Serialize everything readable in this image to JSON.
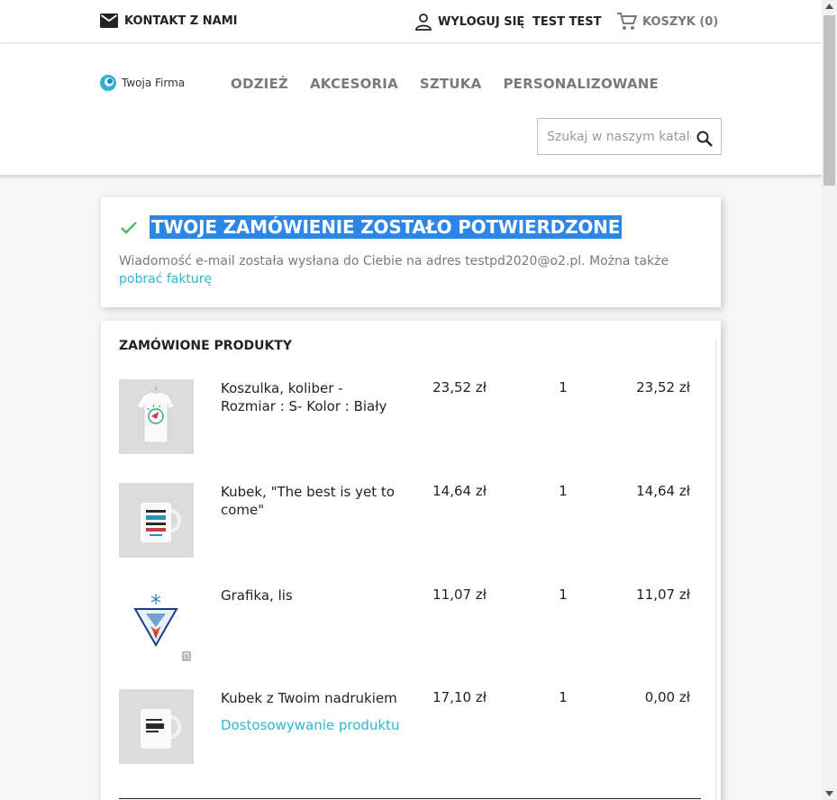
{
  "topbar": {
    "contact_label": "KONTAKT Z NAMI",
    "logout_label": "WYLOGUJ SIĘ",
    "username": "TEST TEST",
    "cart_label": "KOSZYK (0)"
  },
  "header": {
    "logo_text": "Twoja Firma",
    "nav": [
      "ODZIEŻ",
      "AKCESORIA",
      "SZTUKA",
      "PERSONALIZOWANE"
    ],
    "search_placeholder": "Szukaj w naszym katalogu"
  },
  "confirmation": {
    "title": "TWOJE ZAMÓWIENIE ZOSTAŁO POTWIERDZONE",
    "message": "Wiadomość e-mail została wysłana do Ciebie na adres testpd2020@o2.pl. Można także ",
    "invoice_link": "pobrać fakturę"
  },
  "order": {
    "title": "ZAMÓWIONE PRODUKTY",
    "items": [
      {
        "name": "Koszulka, koliber - Rozmiar : S- Kolor : Biały",
        "price": "23,52 zł",
        "qty": "1",
        "total": "23,52 zł",
        "image": "tshirt-hummingbird-icon"
      },
      {
        "name": "Kubek, \"The best is yet to come\"",
        "price": "14,64 zł",
        "qty": "1",
        "total": "14,64 zł",
        "image": "mug-best-icon"
      },
      {
        "name": "Grafika, lis",
        "price": "11,07 zł",
        "qty": "1",
        "total": "11,07 zł",
        "image": "fox-graphic-icon"
      },
      {
        "name": "Kubek z Twoim nadrukiem",
        "customization": "Dostosowywanie produktu",
        "price": "17,10 zł",
        "qty": "1",
        "total": "0,00 zł",
        "image": "mug-custom-icon"
      }
    ]
  },
  "colors": {
    "accent": "#2fb5d2",
    "selection": "#2b86e6",
    "check": "#4cbb6c",
    "text": "#232323",
    "muted": "#7a7a7a"
  }
}
